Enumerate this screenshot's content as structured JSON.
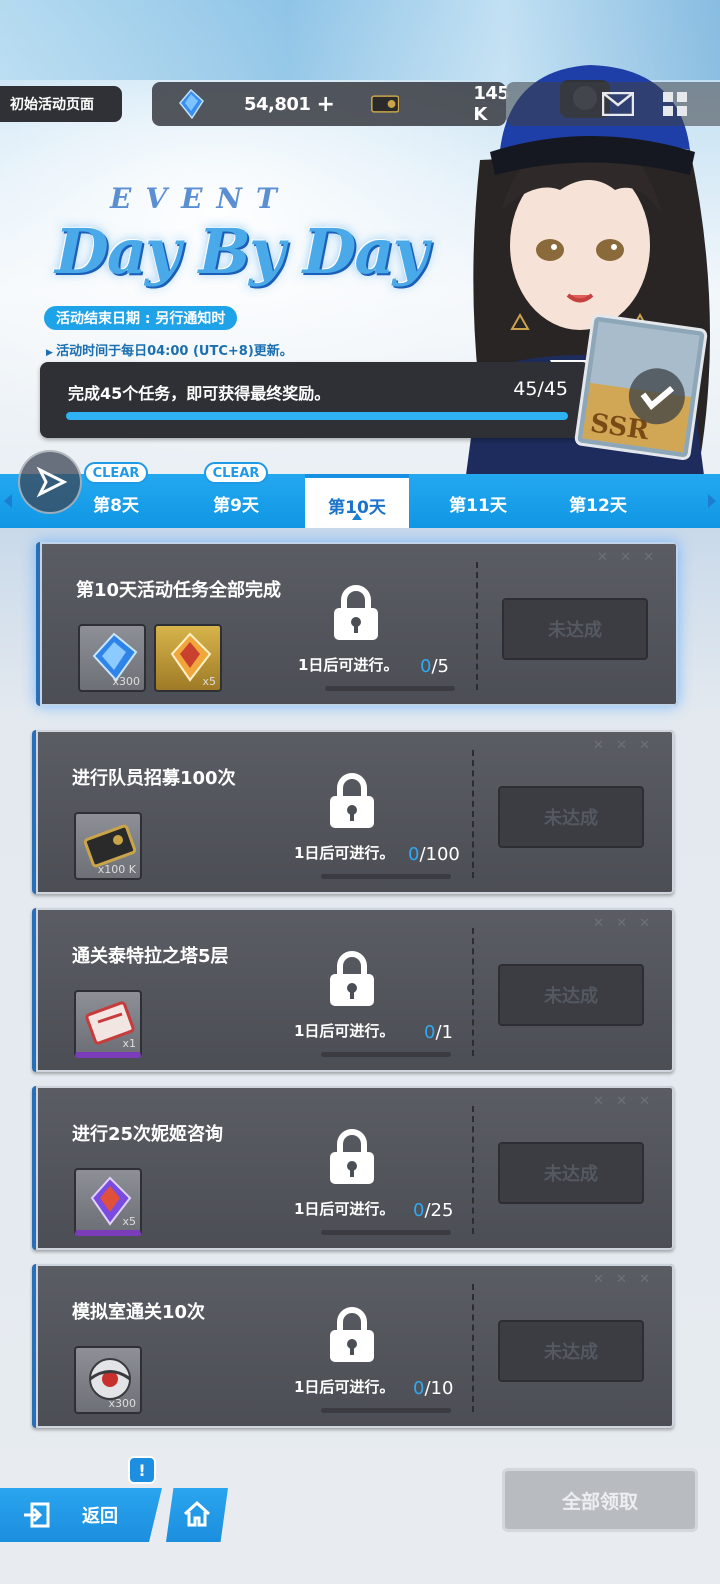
{
  "header": {
    "page_button_label": "初始活动页面",
    "crystal_amount": "54,801",
    "plus_label": "+",
    "ticket_amount": "145 K",
    "icons": [
      "crystal-icon",
      "ticket-icon",
      "mail-icon",
      "menu-icon"
    ]
  },
  "event": {
    "event_word": "EVENT",
    "title": "Day By Day",
    "end_date": "活动结束日期 : 另行通知时",
    "update_note": "活动时间于每日04:00 (UTC+8)更新。",
    "progress_text": "完成45个任务，即可获得最终奖励。",
    "progress_count": "45/45",
    "progress_fraction": 1.0,
    "reward_card_label": "SSR"
  },
  "tabs": [
    {
      "label": "第8天",
      "badge": "CLEAR"
    },
    {
      "label": "第9天",
      "badge": "CLEAR"
    },
    {
      "label": "第10天",
      "badge": ""
    },
    {
      "label": "第11天",
      "badge": ""
    },
    {
      "label": "第12天",
      "badge": ""
    }
  ],
  "tasks": [
    {
      "title": "第10天活动任务全部完成",
      "unlock": "1日后可进行。",
      "current": "0",
      "total": "/5",
      "button": "未达成",
      "rewards": [
        {
          "qty": "x300",
          "kind": "blue-gem"
        },
        {
          "qty": "x5",
          "kind": "gold-gem"
        }
      ]
    },
    {
      "title": "进行队员招募100次",
      "unlock": "1日后可进行。",
      "current": "0",
      "total": "/100",
      "button": "未达成",
      "rewards": [
        {
          "qty": "x100 K",
          "kind": "ticket"
        }
      ]
    },
    {
      "title": "通关泰特拉之塔5层",
      "unlock": "1日后可进行。",
      "current": "0",
      "total": "/1",
      "button": "未达成",
      "rewards": [
        {
          "qty": "x1",
          "kind": "red-ticket"
        }
      ]
    },
    {
      "title": "进行25次妮姬咨询",
      "unlock": "1日后可进行。",
      "current": "0",
      "total": "/25",
      "button": "未达成",
      "rewards": [
        {
          "qty": "x5",
          "kind": "purple-gem"
        }
      ]
    },
    {
      "title": "模拟室通关10次",
      "unlock": "1日后可进行。",
      "current": "0",
      "total": "/10",
      "button": "未达成",
      "rewards": [
        {
          "qty": "x300",
          "kind": "orb"
        }
      ]
    }
  ],
  "footer": {
    "back_label": "返回",
    "alert": "!",
    "claim_all_label": "全部领取"
  },
  "colors": {
    "accent": "#1e9ae6",
    "panel": "#4b4e54",
    "progress_fill": "#2fb2f4"
  }
}
